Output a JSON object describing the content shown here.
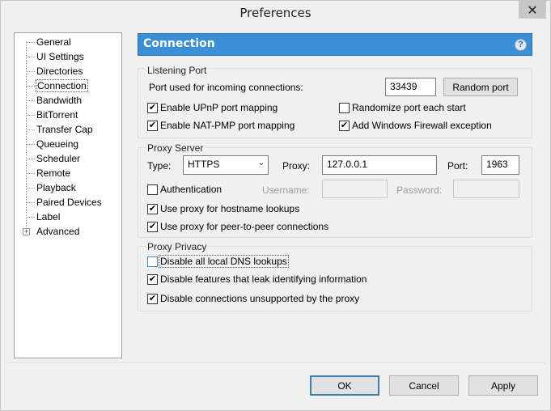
{
  "window": {
    "title": "Preferences",
    "close_glyph": "✕"
  },
  "sidebar": {
    "items": [
      {
        "label": "General"
      },
      {
        "label": "UI Settings"
      },
      {
        "label": "Directories"
      },
      {
        "label": "Connection",
        "selected": true
      },
      {
        "label": "Bandwidth"
      },
      {
        "label": "BitTorrent"
      },
      {
        "label": "Transfer Cap"
      },
      {
        "label": "Queueing"
      },
      {
        "label": "Scheduler"
      },
      {
        "label": "Remote"
      },
      {
        "label": "Playback"
      },
      {
        "label": "Paired Devices"
      },
      {
        "label": "Label"
      },
      {
        "label": "Advanced",
        "expandable": true,
        "expander": "+"
      }
    ]
  },
  "header": {
    "title": "Connection",
    "help_glyph": "?",
    "color": "#3c8ed7"
  },
  "listening_port": {
    "title": "Listening Port",
    "port_label": "Port used for incoming connections:",
    "port_value": "33439",
    "random_button": "Random port",
    "upnp": {
      "label": "Enable UPnP port mapping",
      "checked": true
    },
    "natpmp": {
      "label": "Enable NAT-PMP port mapping",
      "checked": true
    },
    "randomize": {
      "label": "Randomize port each start",
      "checked": false
    },
    "firewall": {
      "label": "Add Windows Firewall exception",
      "checked": true
    }
  },
  "proxy_server": {
    "title": "Proxy Server",
    "type_label": "Type:",
    "type_value": "HTTPS",
    "proxy_label": "Proxy:",
    "proxy_value": "127.0.0.1",
    "port_label": "Port:",
    "port_value": "1963",
    "auth": {
      "label": "Authentication",
      "checked": false
    },
    "username_label": "Username:",
    "username_value": "",
    "password_label": "Password:",
    "password_value": "",
    "hostname": {
      "label": "Use proxy for hostname lookups",
      "checked": true
    },
    "p2p": {
      "label": "Use proxy for peer-to-peer connections",
      "checked": true
    }
  },
  "proxy_privacy": {
    "title": "Proxy Privacy",
    "dns": {
      "label": "Disable all local DNS lookups",
      "checked": false
    },
    "leak": {
      "label": "Disable features that leak identifying information",
      "checked": true
    },
    "unsupported": {
      "label": "Disable connections unsupported by the proxy",
      "checked": true
    }
  },
  "footer": {
    "ok": "OK",
    "cancel": "Cancel",
    "apply": "Apply"
  },
  "check_glyph": "✔",
  "dropdown_arrow": "⌄"
}
